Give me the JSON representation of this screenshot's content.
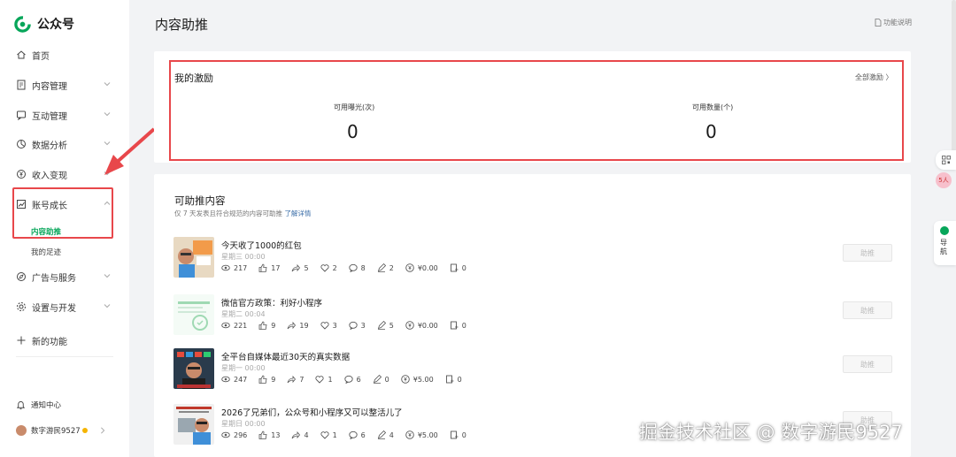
{
  "app": {
    "name": "公众号"
  },
  "nav": [
    {
      "label": "首页",
      "icon": "home-icon",
      "chevron": false
    },
    {
      "label": "内容管理",
      "icon": "document-icon",
      "chevron": true
    },
    {
      "label": "互动管理",
      "icon": "chat-icon",
      "chevron": true
    },
    {
      "label": "数据分析",
      "icon": "pie-chart-icon",
      "chevron": true
    },
    {
      "label": "收入变现",
      "icon": "yen-coin-icon",
      "chevron": true
    },
    {
      "label": "账号成长",
      "icon": "growth-chart-icon",
      "chevron": true,
      "expanded": true
    },
    {
      "label": "广告与服务",
      "icon": "compass-icon",
      "chevron": true
    },
    {
      "label": "设置与开发",
      "icon": "gear-icon",
      "chevron": true
    },
    {
      "label": "新的功能",
      "icon": "plus-icon",
      "chevron": false
    }
  ],
  "sub_nav": [
    {
      "label": "内容助推",
      "active": true
    },
    {
      "label": "我的足迹",
      "active": false
    }
  ],
  "sidebar_bottom": {
    "notify": "通知中心",
    "user": "数字游民9527"
  },
  "page": {
    "title": "内容助推",
    "help": "功能说明"
  },
  "incentive": {
    "title": "我的激励",
    "all_link": "全部激励 〉",
    "stats": [
      {
        "label": "可用曝光(次)",
        "value": "0"
      },
      {
        "label": "可用数量(个)",
        "value": "0"
      }
    ]
  },
  "boostable": {
    "title": "可助推内容",
    "subtitle": "仅 7 天发表且符合规范的内容可助推",
    "subtitle_link": "了解详情",
    "button_label": "助推",
    "items": [
      {
        "title": "今天收了1000的红包",
        "date": "星期三 00:00",
        "metrics": [
          "217",
          "17",
          "5",
          "2",
          "8",
          "2",
          "¥0.00",
          "0"
        ]
      },
      {
        "title": "微信官方政策：利好小程序",
        "date": "星期二 00:04",
        "metrics": [
          "221",
          "9",
          "19",
          "3",
          "3",
          "5",
          "¥0.00",
          "0"
        ]
      },
      {
        "title": "全平台自媒体最近30天的真实数据",
        "date": "星期一 00:00",
        "metrics": [
          "247",
          "9",
          "7",
          "1",
          "6",
          "0",
          "¥5.00",
          "0"
        ]
      },
      {
        "title": "2026了兄弟们，公众号和小程序又可以整活儿了",
        "date": "星期日 00:00",
        "metrics": [
          "296",
          "13",
          "4",
          "1",
          "6",
          "4",
          "¥5.00",
          "0"
        ]
      }
    ]
  },
  "floating": {
    "nav_label": "导航",
    "badge": "5人"
  },
  "watermark": "掘金技术社区 @ 数字游民9527",
  "colors": {
    "brand": "#07a65a",
    "highlight": "#e8474b"
  }
}
